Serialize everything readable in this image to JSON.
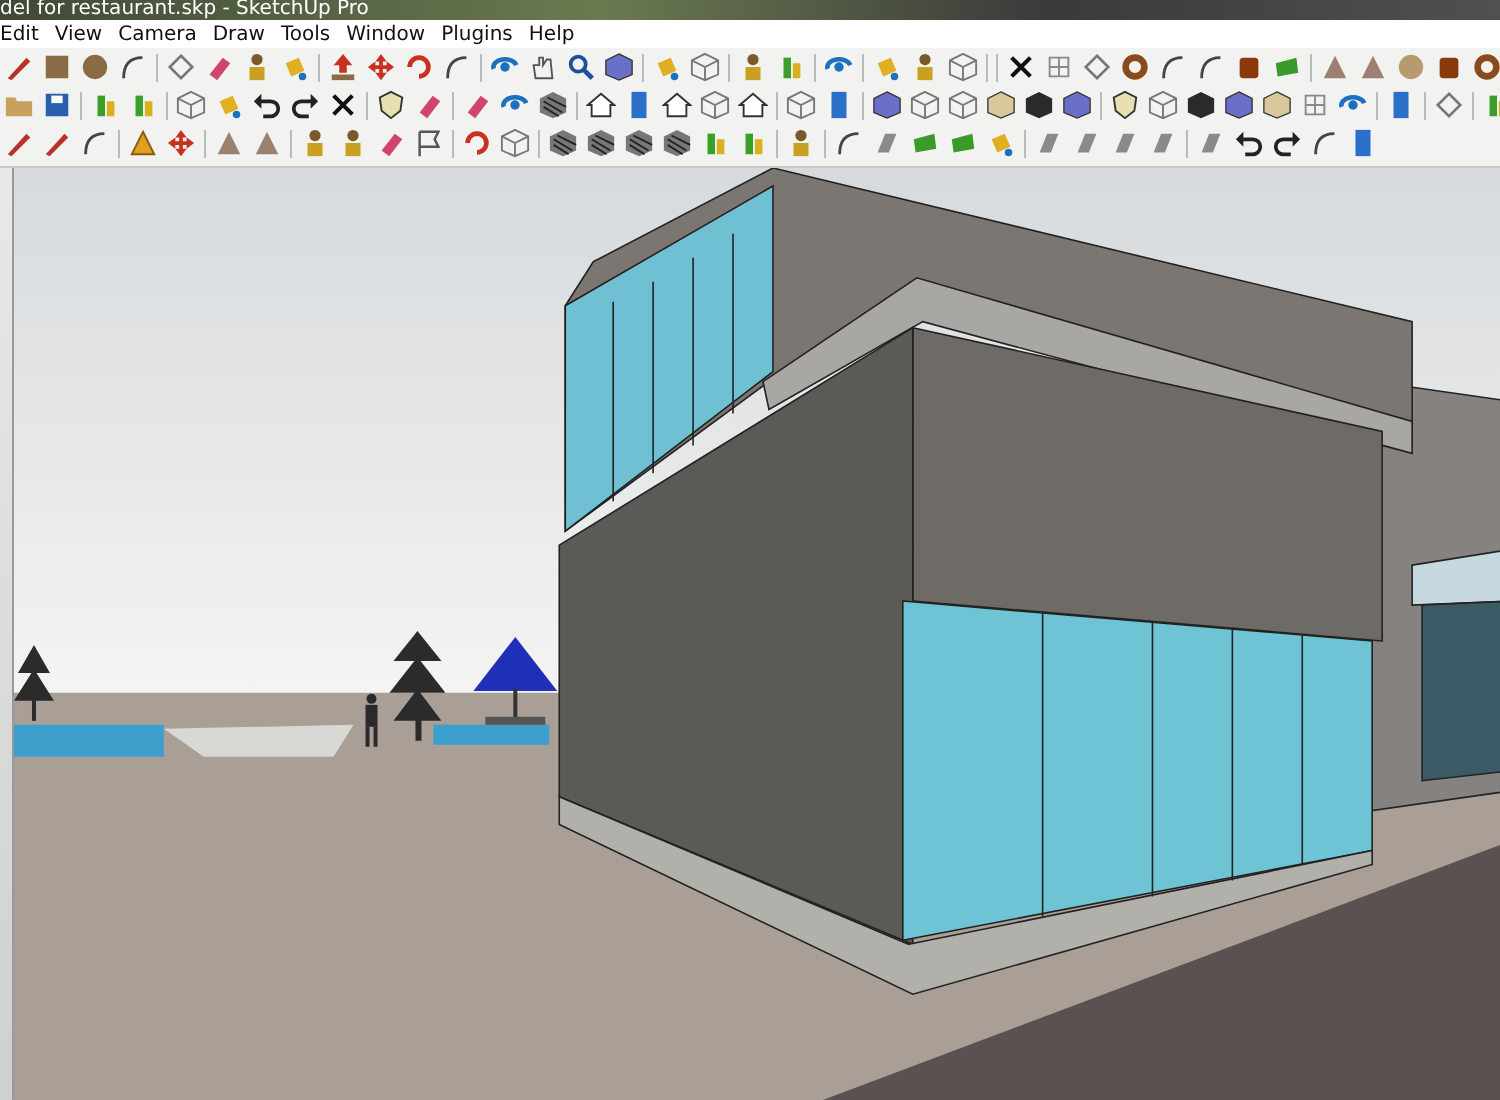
{
  "window": {
    "title": "del for restaurant.skp - SketchUp Pro"
  },
  "menu": [
    {
      "label": "Edit"
    },
    {
      "label": "View"
    },
    {
      "label": "Camera"
    },
    {
      "label": "Draw"
    },
    {
      "label": "Tools"
    },
    {
      "label": "Window"
    },
    {
      "label": "Plugins"
    },
    {
      "label": "Help"
    }
  ]
}
